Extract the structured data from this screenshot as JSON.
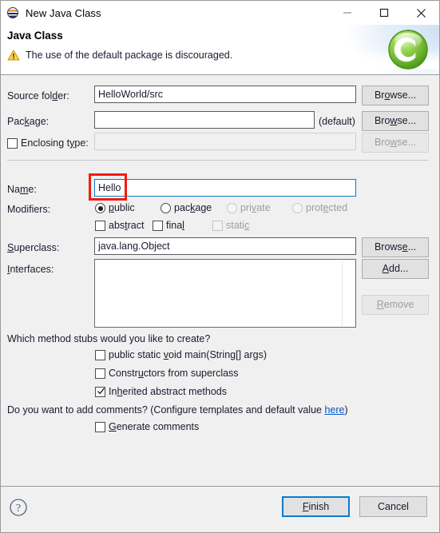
{
  "window": {
    "title": "New Java Class",
    "icon": "java-globe-icon",
    "minimize_label": "—",
    "maximize_label": "□",
    "close_label": "✕"
  },
  "header": {
    "title": "Java Class",
    "message": "The use of the default package is discouraged.",
    "status_icon": "warning-icon",
    "logo_letter": "C",
    "logo_color": "#6fbf2f"
  },
  "form": {
    "source_folder": {
      "label_pre": "Source fol",
      "label_mn": "d",
      "label_post": "er:",
      "value": "HelloWorld/src",
      "browse": {
        "pre": "Br",
        "mn": "o",
        "post": "wse..."
      }
    },
    "package": {
      "label_pre": "Pac",
      "label_mn": "k",
      "label_post": "age:",
      "value": "",
      "hint": "(default)",
      "browse": {
        "pre": "Bro",
        "mn": "w",
        "post": "se..."
      }
    },
    "enclosing_type": {
      "label_pre": "Enclosing t",
      "label_mn": "y",
      "label_post": "pe:",
      "checked": false,
      "value": "",
      "browse": {
        "pre": "Bro",
        "mn": "w",
        "post": "se..."
      }
    },
    "name": {
      "label_pre": "Na",
      "label_mn": "m",
      "label_post": "e:",
      "value": "Hello"
    },
    "modifiers": {
      "label": "Modifiers:",
      "radios": [
        {
          "pre": "",
          "mn": "p",
          "post": "ublic",
          "selected": true,
          "disabled": false
        },
        {
          "pre": "pac",
          "mn": "k",
          "post": "age",
          "selected": false,
          "disabled": false
        },
        {
          "pre": "pri",
          "mn": "v",
          "post": "ate",
          "selected": false,
          "disabled": true
        },
        {
          "pre": "prot",
          "mn": "e",
          "post": "cted",
          "selected": false,
          "disabled": true
        }
      ],
      "checkboxes": [
        {
          "pre": "abs",
          "mn": "t",
          "post": "ract",
          "checked": false,
          "disabled": false
        },
        {
          "pre": "fina",
          "mn": "l",
          "post": "",
          "checked": false,
          "disabled": false
        },
        {
          "pre": "stati",
          "mn": "c",
          "post": "",
          "checked": false,
          "disabled": true
        }
      ]
    },
    "superclass": {
      "label_pre": "",
      "label_mn": "S",
      "label_post": "uperclass:",
      "value": "java.lang.Object",
      "browse": {
        "pre": "Brows",
        "mn": "e",
        "post": "..."
      }
    },
    "interfaces": {
      "label_pre": "",
      "label_mn": "I",
      "label_post": "nterfaces:",
      "items": [],
      "add": {
        "pre": "",
        "mn": "A",
        "post": "dd..."
      },
      "remove": {
        "pre": "",
        "mn": "R",
        "post": "emove"
      }
    }
  },
  "stubs": {
    "question": "Which method stubs would you like to create?",
    "options": [
      {
        "pre": "public static ",
        "mn": "v",
        "post": "oid main(String[] args)",
        "checked": false
      },
      {
        "pre": "Constr",
        "mn": "u",
        "post": "ctors from superclass",
        "checked": false
      },
      {
        "pre": "In",
        "mn": "h",
        "post": "erited abstract methods",
        "checked": true
      }
    ]
  },
  "comments": {
    "question_pre": "Do you want to add comments? (Configure templates and default value ",
    "link": "here",
    "question_post": ")",
    "option": {
      "pre": "",
      "mn": "G",
      "post": "enerate comments",
      "checked": false
    }
  },
  "footer": {
    "help_icon": "help-icon",
    "finish": {
      "pre": "",
      "mn": "F",
      "post": "inish"
    },
    "cancel": "Cancel"
  },
  "annotation": {
    "color": "#f41b10",
    "target": "name-input"
  }
}
